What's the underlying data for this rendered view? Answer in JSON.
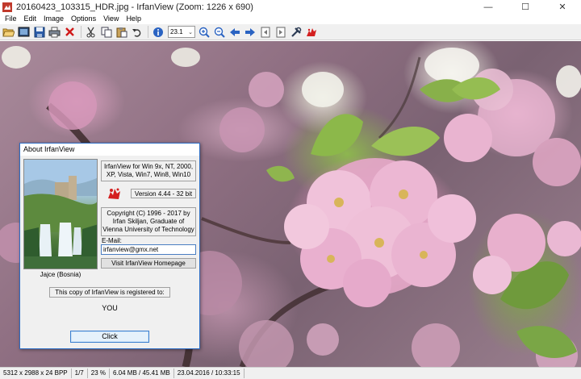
{
  "window": {
    "title": "20160423_103315_HDR.jpg - IrfanView (Zoom: 1226 x 690)",
    "minimize_glyph": "—",
    "maximize_glyph": "☐",
    "close_glyph": "✕"
  },
  "menu": [
    "File",
    "Edit",
    "Image",
    "Options",
    "View",
    "Help"
  ],
  "toolbar": {
    "zoom_value": "23.1",
    "icons": [
      "open-icon",
      "slideshow-icon",
      "save-icon",
      "print-icon",
      "delete-icon",
      "cut-icon",
      "copy-icon",
      "paste-icon",
      "undo-icon",
      "info-icon",
      "zoom-in-icon",
      "zoom-out-icon",
      "previous-icon",
      "next-icon",
      "first-page-icon",
      "last-page-icon",
      "settings-icon",
      "irfanview-logo-icon"
    ]
  },
  "about_dialog": {
    "title": "About  IrfanView",
    "description": "IrfanView for Win 9x, NT, 2000, XP, Vista, Win7, Win8, Win10",
    "version": "Version 4.44 - 32 bit",
    "copyright": "Copyright (C) 1996 - 2017 by Irfan Skiljan, Graduate of Vienna University of Technology",
    "email_label": "E-Mail:",
    "email": "irfanview@gmx.net",
    "homepage_button": "Visit IrfanView Homepage",
    "photo_caption": "Jajce (Bosnia)",
    "registered_label": "This copy of IrfanView is registered to:",
    "registered_user": "YOU",
    "click_button": "Click"
  },
  "status": {
    "dimensions": "5312 x 2988 x 24 BPP",
    "page": "1/7",
    "zoom": "23 %",
    "memory": "6.04 MB / 45.41 MB",
    "datetime": "23.04.2016 / 10:33:15"
  },
  "colors": {
    "accent": "#2b6cc4",
    "toolbar_bg": "#f0f0f0",
    "blossom_pink": "#e8a9c8",
    "leaf_green": "#7fa64a"
  }
}
